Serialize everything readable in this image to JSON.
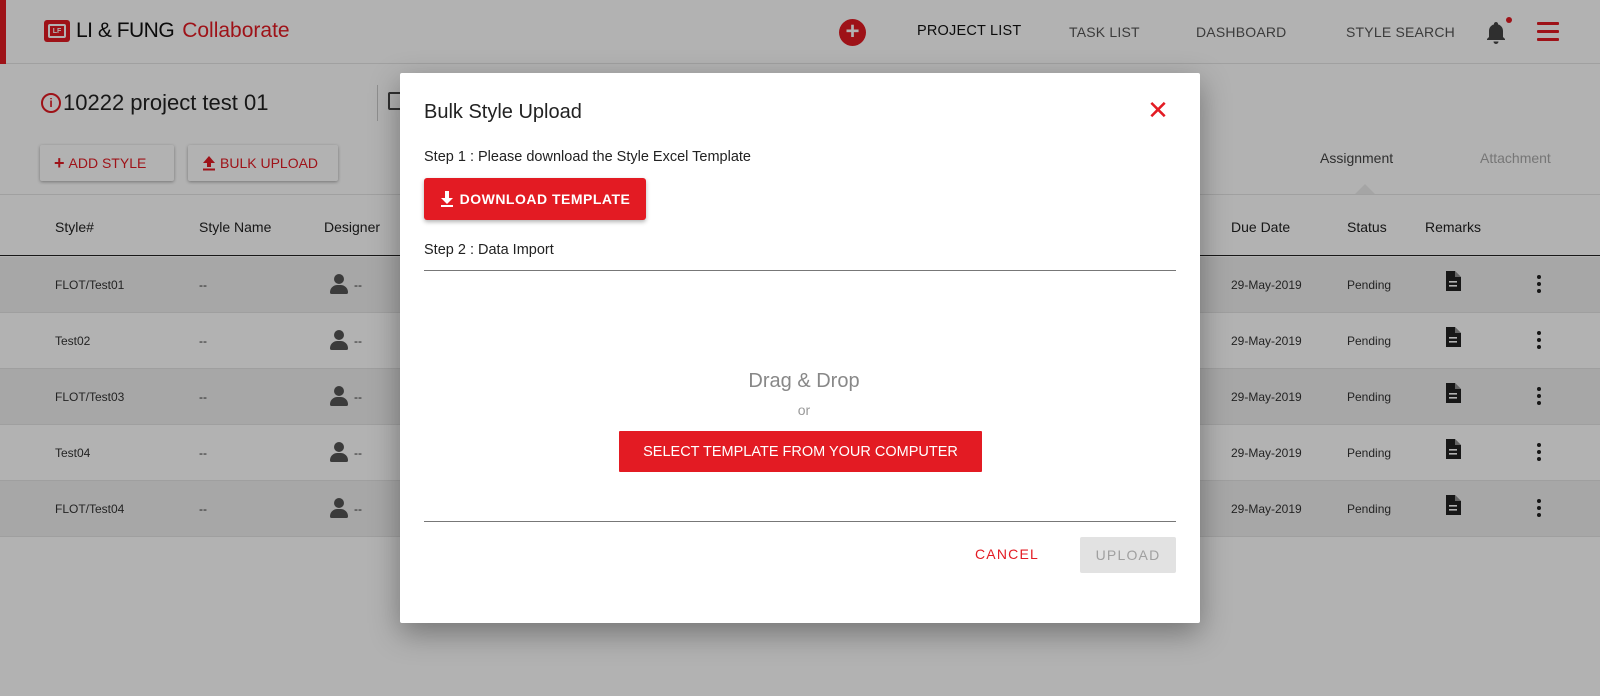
{
  "brand": {
    "logo_text": "LI & FUNG",
    "product": "Collaborate",
    "accent_color": "#e31b23"
  },
  "nav": {
    "items": [
      {
        "label": "PROJECT LIST",
        "active": true
      },
      {
        "label": "TASK LIST",
        "active": false
      },
      {
        "label": "DASHBOARD",
        "active": false
      },
      {
        "label": "STYLE SEARCH",
        "active": false
      }
    ]
  },
  "project": {
    "title": "10222 project test 01"
  },
  "actions": {
    "add_style": "ADD STYLE",
    "bulk_upload": "BULK UPLOAD"
  },
  "tabs": [
    {
      "label": "Assignment",
      "active": true
    },
    {
      "label": "Attachment",
      "active": false
    }
  ],
  "table": {
    "columns": [
      "Style#",
      "Style Name",
      "Designer",
      "Due Date",
      "Status",
      "Remarks"
    ],
    "rows": [
      {
        "style": "FLOT/Test01",
        "name": "--",
        "designer": "--",
        "due": "29-May-2019",
        "status": "Pending"
      },
      {
        "style": "Test02",
        "name": "--",
        "designer": "--",
        "due": "29-May-2019",
        "status": "Pending"
      },
      {
        "style": "FLOT/Test03",
        "name": "--",
        "designer": "--",
        "due": "29-May-2019",
        "status": "Pending"
      },
      {
        "style": "Test04",
        "name": "--",
        "designer": "--",
        "due": "29-May-2019",
        "status": "Pending"
      },
      {
        "style": "FLOT/Test04",
        "name": "--",
        "designer": "--",
        "due": "29-May-2019",
        "status": "Pending"
      }
    ]
  },
  "modal": {
    "title": "Bulk Style Upload",
    "step1": "Step 1 : Please download the Style Excel Template",
    "download_label": "DOWNLOAD TEMPLATE",
    "step2": "Step 2 : Data Import",
    "drag_drop": "Drag & Drop",
    "or": "or",
    "select_label": "SELECT TEMPLATE FROM YOUR COMPUTER",
    "cancel_label": "CANCEL",
    "upload_label": "UPLOAD"
  }
}
